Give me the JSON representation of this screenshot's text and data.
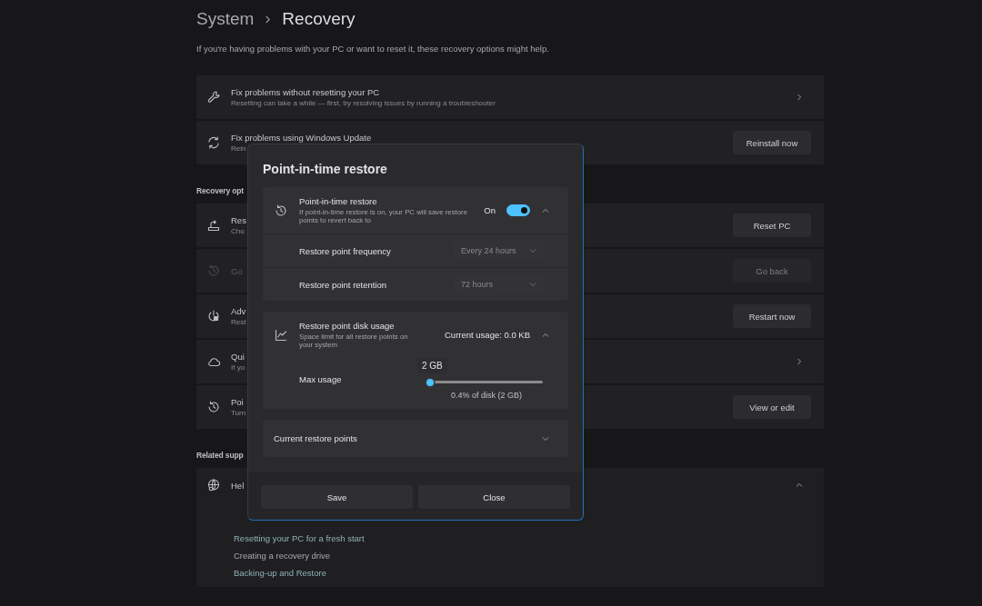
{
  "page": {
    "breadcrumb": [
      "System",
      "Recovery"
    ],
    "description": "If you're having problems with your PC or want to reset it, these recovery options might help."
  },
  "top_options": [
    {
      "title": "Fix problems without resetting your PC",
      "subtitle": "Resetting can take a while — first, try resolving issues by running a troubleshooter",
      "kind": "chevron"
    },
    {
      "title": "Fix problems using Windows Update",
      "subtitle": "Rein",
      "kind": "button",
      "button": "Reinstall now"
    }
  ],
  "recovery_section": {
    "heading": "Recovery opt",
    "options": [
      {
        "title": "Res",
        "subtitle": "Cho",
        "kind": "button",
        "button": "Reset PC",
        "disabled": false
      },
      {
        "title": "Go",
        "kind": "button",
        "button": "Go back",
        "disabled": true
      },
      {
        "title": "Adv",
        "subtitle": "Rest",
        "kind": "button",
        "button": "Restart now",
        "disabled": false
      },
      {
        "title": "Qui",
        "subtitle": "If yo",
        "kind": "chevron",
        "disabled": false
      },
      {
        "title": "Poi",
        "subtitle": "Turn",
        "kind": "button",
        "button": "View or edit",
        "disabled": false
      }
    ]
  },
  "related_section": {
    "heading": "Related supp",
    "help": {
      "title": "Hel",
      "expanded": true,
      "links": [
        "Resetting your PC for a fresh start",
        "Creating a recovery drive",
        "Backing-up and Restore"
      ]
    }
  },
  "dialog": {
    "title": "Point-in-time restore",
    "restore": {
      "title": "Point-in-time restore",
      "description": "If point-in-time restore is on, your PC will save restore points to revert back to",
      "state_label": "On",
      "on": true,
      "expanded": true,
      "settings": [
        {
          "label": "Restore point frequency",
          "value": "Every 24 hours",
          "disabled": true
        },
        {
          "label": "Restore point retention",
          "value": "72 hours",
          "disabled": true
        }
      ]
    },
    "disk_usage": {
      "title": "Restore point disk usage",
      "description": "Space limit for all restore points on your system",
      "current_usage": "Current usage: 0.0 KB",
      "expanded": true,
      "slider_label": "Max usage",
      "tooltip": "2 GB",
      "level": 0.0,
      "reading": "0.4% of disk (2 GB)"
    },
    "restore_points": {
      "title": "Current restore points",
      "expanded": false
    },
    "buttons": [
      "Save",
      "Close"
    ]
  }
}
